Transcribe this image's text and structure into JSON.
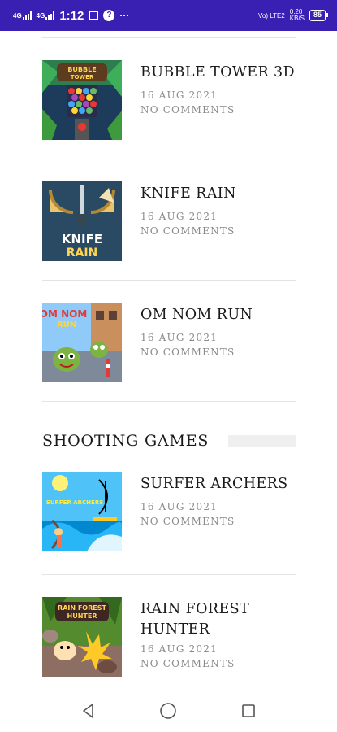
{
  "status_bar": {
    "time": "1:12",
    "net1": "4G",
    "net2": "4G",
    "speed": "0.20",
    "speed_unit": "KB/S",
    "volte": "Vo) LTE2",
    "battery": "85",
    "more": "···",
    "q": "?"
  },
  "posts_top": [
    {
      "title": "BUBBLE TOWER 3D",
      "date": "16 AUG 2021",
      "comments": "NO COMMENTS",
      "thumb_text": "BUBBLE TOWER"
    },
    {
      "title": "KNIFE RAIN",
      "date": "16 AUG 2021",
      "comments": "NO COMMENTS",
      "thumb_text": "KNIFE RAIN"
    },
    {
      "title": "OM NOM RUN",
      "date": "16 AUG 2021",
      "comments": "NO COMMENTS",
      "thumb_text": "OM NOM RUN"
    }
  ],
  "section": {
    "title": "SHOOTING GAMES"
  },
  "posts_bottom": [
    {
      "title": "SURFER ARCHERS",
      "date": "16 AUG 2021",
      "comments": "NO COMMENTS",
      "thumb_text": "SURFER ARCHERS"
    },
    {
      "title": "RAIN FOREST HUNTER",
      "date": "16 AUG 2021",
      "comments": "NO COMMENTS",
      "thumb_text": "RAIN FOREST HUNTER"
    }
  ],
  "nav": {
    "back": "back-icon",
    "home": "home-icon",
    "recents": "recents-icon"
  },
  "colors": {
    "status_bg": "#3a1fb3",
    "divider": "#e3e3e3",
    "meta": "#8a8a8a"
  }
}
